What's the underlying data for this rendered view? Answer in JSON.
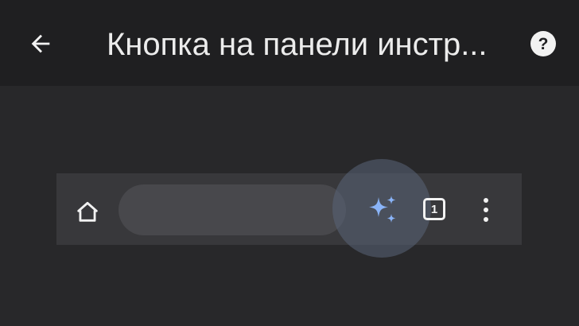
{
  "header": {
    "title": "Кнопка на панели инстр...",
    "back_icon": "arrow-left-icon",
    "help_icon": "help-circle-icon",
    "help_glyph": "?"
  },
  "preview": {
    "home_icon": "home-icon",
    "shortcut_icon": "sparkle-icon",
    "tab_count": "1",
    "menu_icon": "more-vert-icon"
  },
  "colors": {
    "background": "#28282a",
    "app_bar": "#1f1f21",
    "toolbar": "#38383b",
    "omnibox": "#48484c",
    "accent_sparkle": "#8ab4f8"
  }
}
